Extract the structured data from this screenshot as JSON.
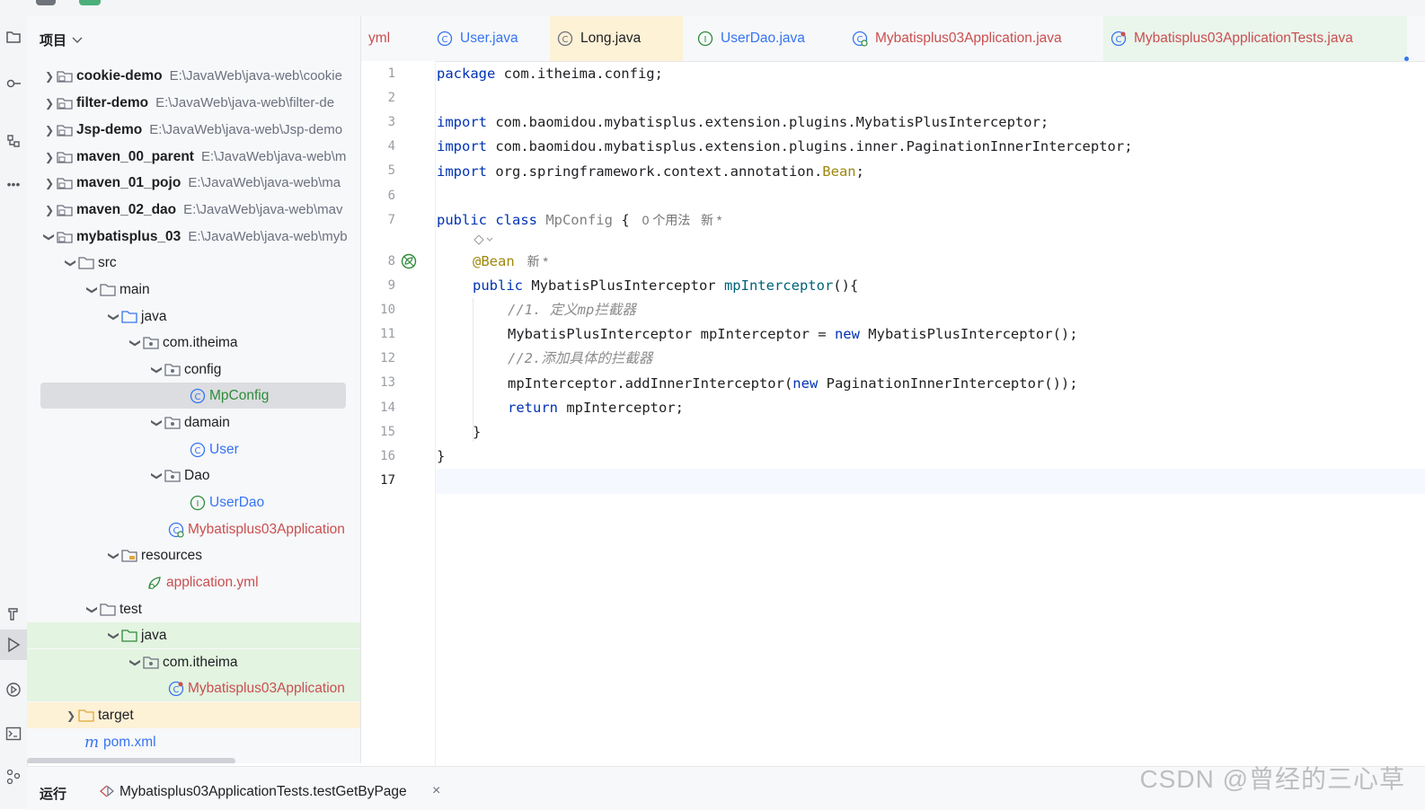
{
  "project_panel": {
    "title": "项目",
    "tree": [
      {
        "name": "cookie-demo",
        "path": "E:\\JavaWeb\\java-web\\cookie"
      },
      {
        "name": "filter-demo",
        "path": "E:\\JavaWeb\\java-web\\filter-de"
      },
      {
        "name": "Jsp-demo",
        "path": "E:\\JavaWeb\\java-web\\Jsp-demo"
      },
      {
        "name": "maven_00_parent",
        "path": "E:\\JavaWeb\\java-web\\m"
      },
      {
        "name": "maven_01_pojo",
        "path": "E:\\JavaWeb\\java-web\\ma"
      },
      {
        "name": "maven_02_dao",
        "path": "E:\\JavaWeb\\java-web\\mav"
      },
      {
        "name": "mybatisplus_03",
        "path": "E:\\JavaWeb\\java-web\\myb"
      },
      {
        "name": "src"
      },
      {
        "name": "main"
      },
      {
        "name": "java"
      },
      {
        "name": "com.itheima"
      },
      {
        "name": "config"
      },
      {
        "name": "MpConfig"
      },
      {
        "name": "damain"
      },
      {
        "name": "User"
      },
      {
        "name": "Dao"
      },
      {
        "name": "UserDao"
      },
      {
        "name": "Mybatisplus03Application"
      },
      {
        "name": "resources"
      },
      {
        "name": "application.yml"
      },
      {
        "name": "test"
      },
      {
        "name": "java"
      },
      {
        "name": "com.itheima"
      },
      {
        "name": "Mybatisplus03Application"
      },
      {
        "name": "target"
      },
      {
        "name": "pom.xml"
      }
    ]
  },
  "tabs": [
    {
      "label": "yml"
    },
    {
      "label": "User.java"
    },
    {
      "label": "Long.java"
    },
    {
      "label": "UserDao.java"
    },
    {
      "label": "Mybatisplus03Application.java"
    },
    {
      "label": "Mybatisplus03ApplicationTests.java"
    }
  ],
  "editor": {
    "line_numbers": [
      "1",
      "2",
      "3",
      "4",
      "5",
      "6",
      "7",
      "8",
      "9",
      "10",
      "11",
      "12",
      "13",
      "14",
      "15",
      "16",
      "17"
    ],
    "code": {
      "l1_kw": "package",
      "l1_rest": " com.itheima.config;",
      "l3_kw": "import",
      "l3_rest": " com.baomidou.mybatisplus.extension.plugins.MybatisPlusInterceptor;",
      "l4_kw": "import",
      "l4_rest": " com.baomidou.mybatisplus.extension.plugins.inner.PaginationInnerInterceptor;",
      "l5_kw": "import",
      "l5_rest": " org.springframework.context.annotation.",
      "l5_bean": "Bean",
      "l5_end": ";",
      "l7_kw": "public class",
      "l7_name": " MpConfig",
      "l7_brace": " {",
      "l7_hint": "0 个用法   新 *",
      "l8_ann": "@Bean",
      "l8_hint": "新 *",
      "l9_kw": "public",
      "l9_type": " MybatisPlusInterceptor ",
      "l9_fn": "mpInterceptor",
      "l9_end": "(){",
      "l10_cm": "//1. 定义mp拦截器",
      "l11_a": "MybatisPlusInterceptor mpInterceptor = ",
      "l11_kw": "new",
      "l11_b": " MybatisPlusInterceptor();",
      "l12_cm": "//2.添加具体的拦截器",
      "l13_a": "mpInterceptor.addInnerInterceptor(",
      "l13_kw": "new",
      "l13_b": " PaginationInnerInterceptor());",
      "l14_kw": "return",
      "l14_rest": " mpInterceptor;",
      "l15": "}",
      "l16": "}"
    }
  },
  "bottom": {
    "run_label": "运行",
    "run_config": "Mybatisplus03ApplicationTests.testGetByPage",
    "close_glyph": "×"
  },
  "watermark": "CSDN @曾经的三心草",
  "colors": {
    "keyword": "#0033b3",
    "annotation": "#9e880d",
    "method": "#00627a",
    "accent": "#3574f0"
  }
}
